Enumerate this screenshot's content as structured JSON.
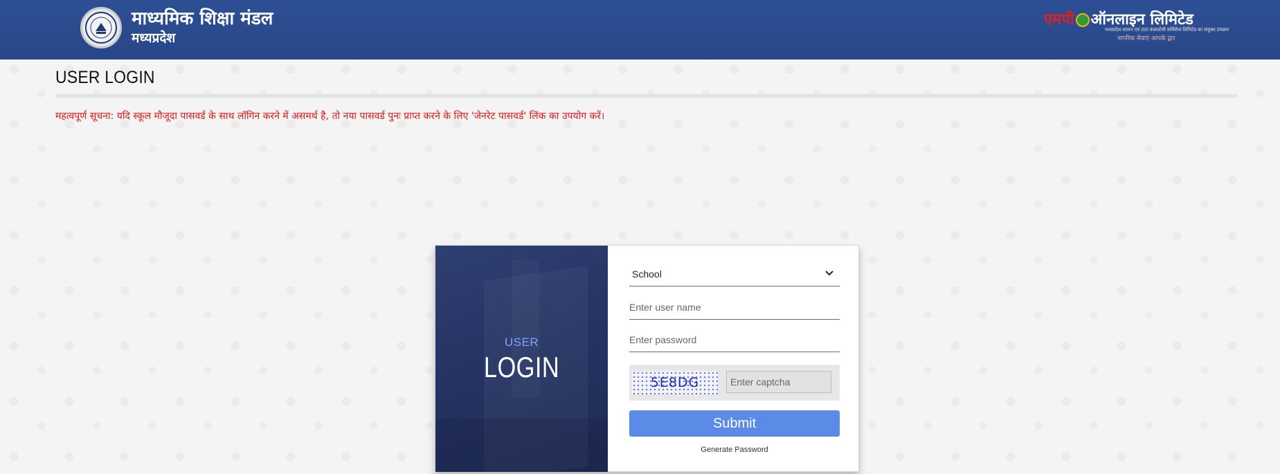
{
  "header": {
    "title": "माध्यमिक शिक्षा मंडल",
    "subtitle": "मध्यप्रदेश",
    "seal_icon": "mpbse-seal-icon",
    "partner": {
      "name_red": "एमपी",
      "name_white": "ऑनलाइन लिमिटेड",
      "tagline": "मध्यप्रदेश शासन एवं टाटा कंसल्टेंसी सर्विसेज लिमिटेड का संयुक्त उपक्रम",
      "slogan": "नागरिक सेवाएं आपके द्वार"
    }
  },
  "page": {
    "heading": "USER LOGIN",
    "notice": "महत्वपूर्ण सूचना: यदि स्कूल मौजूदा पासवर्ड के साथ लॉगिन करने में असमर्थ है, तो नया पासवर्ड पुनः प्राप्त करने के लिए 'जेनरेट पासवर्ड' लिंक का उपयोग करें।"
  },
  "login": {
    "panel_user": "USER",
    "panel_login": "LOGIN",
    "user_type_selected": "School",
    "username_placeholder": "Enter user name",
    "password_placeholder": "Enter password",
    "captcha_text": "5E8DG",
    "captcha_placeholder": "Enter captcha",
    "submit_label": "Submit",
    "generate_password_label": "Generate Password"
  },
  "colors": {
    "header_bg": "#2b4c8e",
    "notice_text": "#e01515",
    "submit_bg": "#5b8be6",
    "panel_accent": "#7fa2ff"
  }
}
